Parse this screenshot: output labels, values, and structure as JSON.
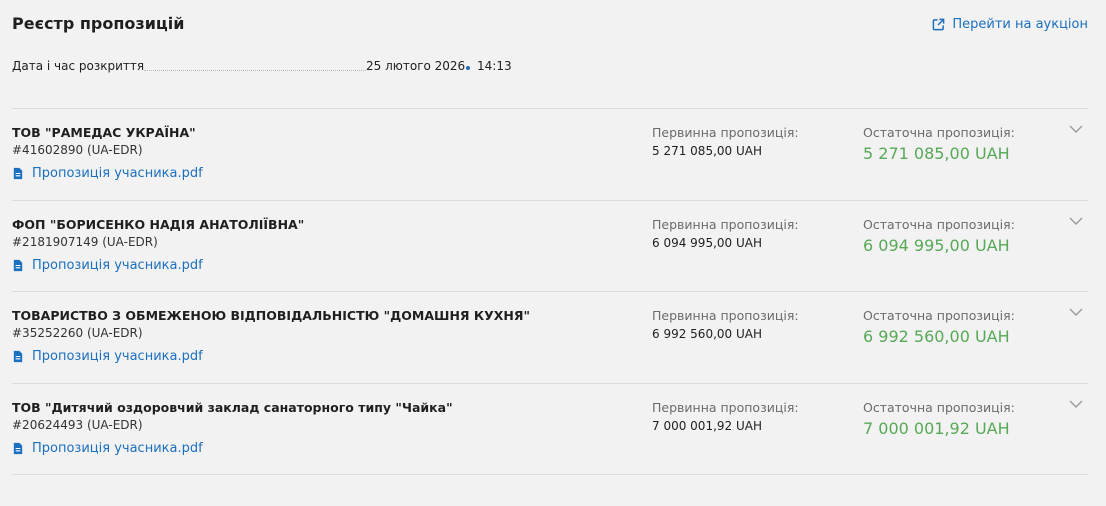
{
  "header": {
    "title": "Реєстр пропозицій",
    "auction_link": "Перейти на аукціон"
  },
  "opening": {
    "label": "Дата і час розкриття",
    "date": "25 лютого 2026",
    "time": "14:13"
  },
  "columns": {
    "initial_label": "Первинна пропозиція:",
    "final_label": "Остаточна пропозиція:"
  },
  "colors": {
    "accent": "#1b6fbf",
    "final_value": "#57a957"
  },
  "bids": [
    {
      "name": "ТОВ \"РАМЕДАС УКРАЇНА\"",
      "edr": "#41602890 (UA-EDR)",
      "file": "Пропозиція учасника.pdf",
      "initial": "5 271 085,00 UAH",
      "final": "5 271 085,00 UAH"
    },
    {
      "name": "ФОП \"БОРИСЕНКО НАДІЯ АНАТОЛІЇВНА\"",
      "edr": "#2181907149 (UA-EDR)",
      "file": "Пропозиція учасника.pdf",
      "initial": "6 094 995,00 UAH",
      "final": "6 094 995,00 UAH"
    },
    {
      "name": "ТОВАРИСТВО З ОБМЕЖЕНОЮ ВІДПОВІДАЛЬНІСТЮ \"ДОМАШНЯ КУХНЯ\"",
      "edr": "#35252260 (UA-EDR)",
      "file": "Пропозиція учасника.pdf",
      "initial": "6 992 560,00 UAH",
      "final": "6 992 560,00 UAH"
    },
    {
      "name": "ТОВ \"Дитячий оздоровчий заклад санаторного типу \"Чайка\"",
      "edr": "#20624493 (UA-EDR)",
      "file": "Пропозиція учасника.pdf",
      "initial": "7 000 001,92 UAH",
      "final": "7 000 001,92 UAH"
    }
  ]
}
